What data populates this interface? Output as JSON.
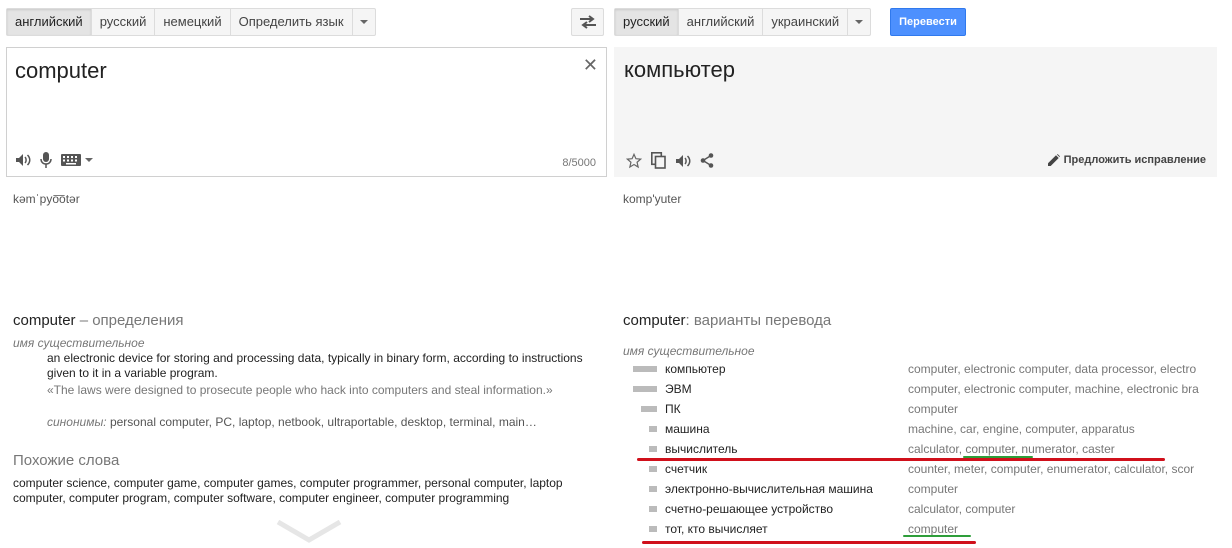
{
  "source_langs": {
    "tabs": [
      "английский",
      "русский",
      "немецкий",
      "Определить язык"
    ],
    "active": 0
  },
  "target_langs": {
    "tabs": [
      "русский",
      "английский",
      "украинский"
    ],
    "active": 0
  },
  "translate_label": "Перевести",
  "source": {
    "text": "computer",
    "char_count": "8/5000",
    "transliteration": "kəmˈpyo͞otər"
  },
  "target": {
    "text": "компьютер",
    "suggest_label": "Предложить исправление",
    "transliteration": "komp'yuter"
  },
  "definitions": {
    "word": "computer",
    "suffix": " – определения",
    "pos": "имя существительное",
    "text": "an electronic device for storing and processing data, typically in binary form, according to instructions given to it in a variable program.",
    "example": "«The laws were designed to prosecute people who hack into computers and steal information.»",
    "synonyms_label": "синонимы:",
    "synonyms": " personal computer, PC, laptop, netbook, ultraportable, desktop, terminal, main…"
  },
  "related": {
    "title": "Похожие слова",
    "text": "computer science, computer game, computer games, computer programmer, personal computer, laptop computer, computer program, computer software, computer engineer, computer programming"
  },
  "translations": {
    "word": "computer",
    "suffix": ": варианты перевода",
    "pos": "имя существительное",
    "rows": [
      {
        "word": "компьютер",
        "back": "computer, electronic computer, data processor, electro",
        "freq": 1.0
      },
      {
        "word": "ЭВМ",
        "back": "computer, electronic computer, machine, electronic bra",
        "freq": 1.0
      },
      {
        "word": "ПК",
        "back": "computer",
        "freq": 0.67
      },
      {
        "word": "машина",
        "back": "machine, car, engine, computer, apparatus",
        "freq": 0.33
      },
      {
        "word": "вычислитель",
        "back": "calculator, computer, numerator, caster",
        "freq": 0.33
      },
      {
        "word": "счетчик",
        "back": "counter, meter, computer, enumerator, calculator, scor",
        "freq": 0.33
      },
      {
        "word": "электронно-вычислительная машина",
        "back": "computer",
        "freq": 0.33
      },
      {
        "word": "счетно-решающее устройство",
        "back": "calculator, computer",
        "freq": 0.33
      },
      {
        "word": "тот, кто вычисляет",
        "back": "computer",
        "freq": 0.33
      }
    ]
  },
  "colors": {
    "annotation_red": "#d0101b",
    "annotation_green": "#2e9e3a",
    "translate_blue": "#4d90fe"
  }
}
